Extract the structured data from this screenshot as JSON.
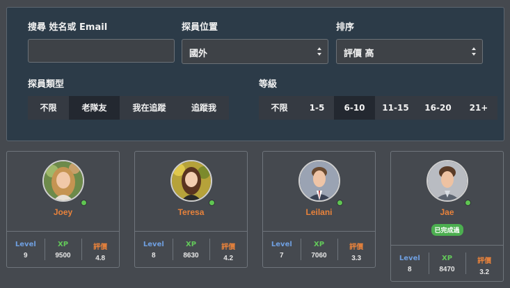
{
  "filters": {
    "search_label": "搜尋 姓名或 Email",
    "search_value": "",
    "location_label": "探員位置",
    "location_value": "國外",
    "sort_label": "排序",
    "sort_value": "評價 高",
    "type_label": "探員類型",
    "type_options": [
      "不限",
      "老隊友",
      "我在追蹤",
      "追蹤我"
    ],
    "type_selected": "老隊友",
    "level_label": "等級",
    "level_options": [
      "不限",
      "1-5",
      "6-10",
      "11-15",
      "16-20",
      "21+"
    ],
    "level_selected": "6-10"
  },
  "stat_labels": {
    "level": "Level",
    "xp": "XP",
    "rating": "評價"
  },
  "cards": [
    {
      "name": "Joey",
      "online": true,
      "badge": "",
      "level": "9",
      "xp": "9500",
      "rating": "4.8"
    },
    {
      "name": "Teresa",
      "online": true,
      "badge": "",
      "level": "8",
      "xp": "8630",
      "rating": "4.2"
    },
    {
      "name": "Leilani",
      "online": true,
      "badge": "",
      "level": "7",
      "xp": "7060",
      "rating": "3.3"
    },
    {
      "name": "Jae",
      "online": true,
      "badge": "已完成過",
      "level": "8",
      "xp": "8470",
      "rating": "3.2"
    }
  ],
  "colors": {
    "panel_bg": "#2c3b48",
    "page_bg": "#45494f",
    "name_orange": "#e8823b",
    "level_blue": "#6f9fe0",
    "xp_green": "#63c95a",
    "badge_green": "#4caf50",
    "online_green": "#5fc552"
  }
}
